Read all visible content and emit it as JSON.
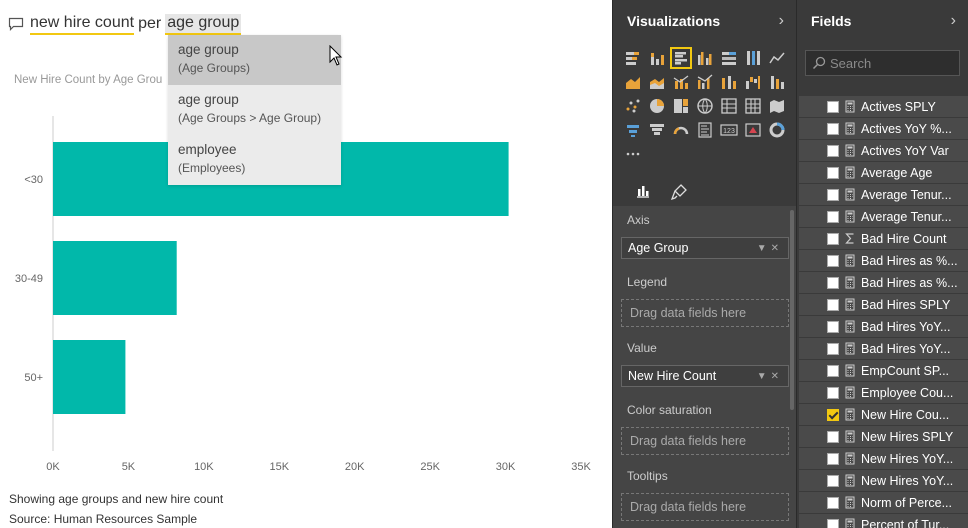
{
  "qna": {
    "part1": "new hire count",
    "part2": "per",
    "part3": "age group"
  },
  "suggestions": [
    {
      "label": "age group",
      "sub": "(Age Groups)"
    },
    {
      "label": "age group",
      "sub": "(Age Groups > Age Group)"
    },
    {
      "label": "employee",
      "sub": "(Employees)"
    }
  ],
  "chart_title": "New Hire Count by Age Grou",
  "chart_data": {
    "type": "bar",
    "orientation": "horizontal",
    "categories": [
      "<30",
      "30-49",
      "50+"
    ],
    "values": [
      30200,
      8200,
      4800
    ],
    "xlim": [
      0,
      35000
    ],
    "xticks": [
      "0K",
      "5K",
      "10K",
      "15K",
      "20K",
      "25K",
      "30K",
      "35K"
    ],
    "bar_color": "#01b8aa"
  },
  "footer": {
    "line1": "Showing age groups and new hire count",
    "line2": "Source: Human Resources Sample"
  },
  "viz_pane": {
    "title": "Visualizations",
    "wells": {
      "axis_label": "Axis",
      "axis_value": "Age Group",
      "legend_label": "Legend",
      "legend_placeholder": "Drag data fields here",
      "value_label": "Value",
      "value_value": "New Hire Count",
      "color_label": "Color saturation",
      "color_placeholder": "Drag data fields here",
      "tooltips_label": "Tooltips",
      "tooltips_placeholder": "Drag data fields here"
    }
  },
  "fields_pane": {
    "title": "Fields",
    "search_placeholder": "Search",
    "items": [
      {
        "name": "Actives SPLY",
        "checked": false,
        "icon": "calc-icon"
      },
      {
        "name": "Actives YoY %...",
        "checked": false,
        "icon": "calc-icon"
      },
      {
        "name": "Actives YoY Var",
        "checked": false,
        "icon": "calc-icon"
      },
      {
        "name": "Average Age",
        "checked": false,
        "icon": "calc-icon"
      },
      {
        "name": "Average Tenur...",
        "checked": false,
        "icon": "calc-icon"
      },
      {
        "name": "Average Tenur...",
        "checked": false,
        "icon": "calc-icon"
      },
      {
        "name": "Bad Hire Count",
        "checked": false,
        "icon": "sigma-icon"
      },
      {
        "name": "Bad Hires as %...",
        "checked": false,
        "icon": "calc-icon"
      },
      {
        "name": "Bad Hires as %...",
        "checked": false,
        "icon": "calc-icon"
      },
      {
        "name": "Bad Hires SPLY",
        "checked": false,
        "icon": "calc-icon"
      },
      {
        "name": "Bad Hires YoY...",
        "checked": false,
        "icon": "calc-icon"
      },
      {
        "name": "Bad Hires YoY...",
        "checked": false,
        "icon": "calc-icon"
      },
      {
        "name": "EmpCount SP...",
        "checked": false,
        "icon": "calc-icon"
      },
      {
        "name": "Employee Cou...",
        "checked": false,
        "icon": "calc-icon"
      },
      {
        "name": "New Hire Cou...",
        "checked": true,
        "icon": "calc-icon"
      },
      {
        "name": "New Hires SPLY",
        "checked": false,
        "icon": "calc-icon"
      },
      {
        "name": "New Hires YoY...",
        "checked": false,
        "icon": "calc-icon"
      },
      {
        "name": "New Hires YoY...",
        "checked": false,
        "icon": "calc-icon"
      },
      {
        "name": "Norm of Perce...",
        "checked": false,
        "icon": "calc-icon"
      },
      {
        "name": "Percent of Tur...",
        "checked": false,
        "icon": "calc-icon"
      }
    ]
  }
}
